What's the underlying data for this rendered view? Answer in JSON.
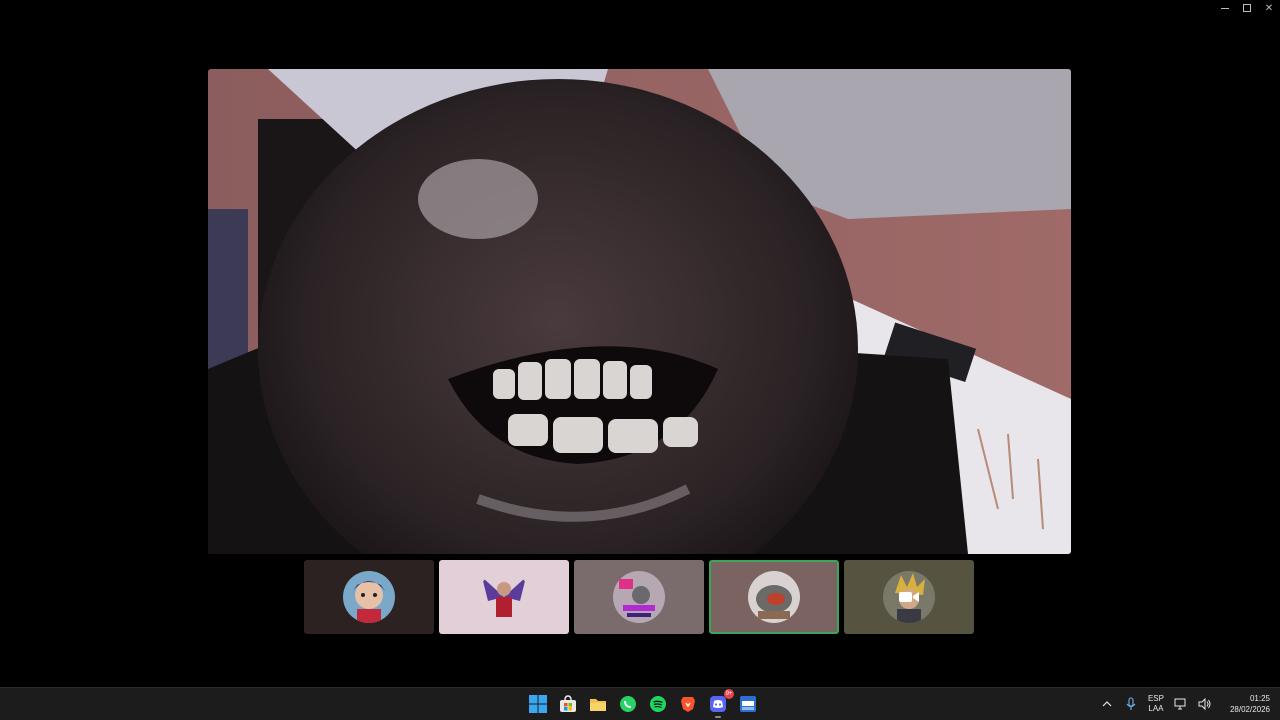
{
  "window": {
    "controls": [
      "minimize",
      "maximize",
      "close"
    ]
  },
  "main_video": {
    "description_icon": "camera-feed"
  },
  "participants": [
    {
      "tile_color": "#2b2221",
      "avatar": "anime-character-avatar",
      "active": false
    },
    {
      "tile_color": "#e2cfd8",
      "avatar": "winged-figure-avatar",
      "active": false
    },
    {
      "tile_color": "#7a6b6d",
      "avatar": "pixel-art-avatar",
      "active": false
    },
    {
      "tile_color": "#7b6362",
      "avatar": "helmet-avatar",
      "active": true
    },
    {
      "tile_color": "#565440",
      "avatar": "spiky-hair-avatar",
      "active": false,
      "camera_icon": "video-camera-icon"
    }
  ],
  "taskbar": {
    "apps": [
      {
        "name": "start-icon"
      },
      {
        "name": "store-icon"
      },
      {
        "name": "file-explorer-icon"
      },
      {
        "name": "whatsapp-icon"
      },
      {
        "name": "spotify-icon"
      },
      {
        "name": "brave-icon"
      },
      {
        "name": "discord-icon",
        "badge": "9+"
      },
      {
        "name": "app-icon"
      }
    ],
    "tray": {
      "language_top": "ESP",
      "language_bottom": "LAA",
      "time": "01:25",
      "date": "28/02/2026"
    }
  },
  "colors": {
    "active_border": "#3ba55c",
    "taskbar_bg": "#1c1c1c",
    "badge": "#e8414b"
  }
}
